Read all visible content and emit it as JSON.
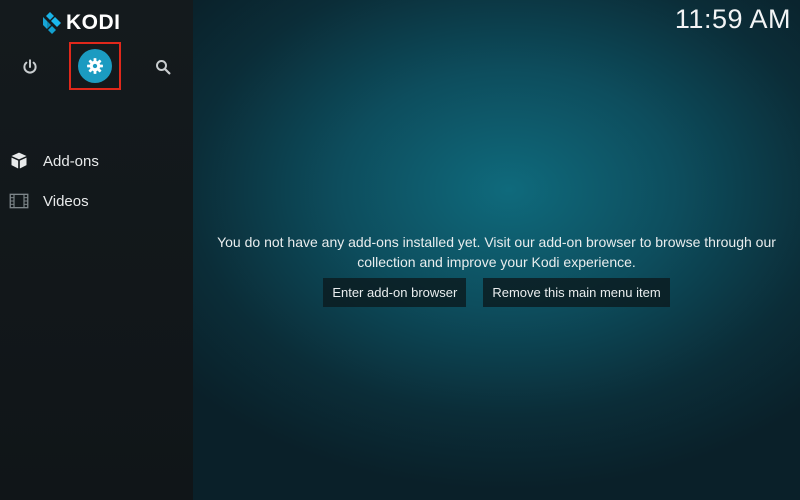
{
  "app": {
    "logo_text": "KODI",
    "clock": "11:59 AM"
  },
  "top_bar": {
    "power_icon": "power-icon",
    "settings_icon": "gear-icon",
    "search_icon": "search-icon",
    "settings_highlight_color": "#e0281b",
    "settings_bg_color": "#1b9bc1"
  },
  "menu": {
    "items": [
      {
        "label": "Add-ons",
        "icon": "addons-box-icon"
      },
      {
        "label": "Videos",
        "icon": "film-strip-icon"
      }
    ]
  },
  "main": {
    "message_line1": "You do not have any add-ons installed yet. Visit our add-on browser to browse through our",
    "message_line2": "collection and improve your Kodi experience.",
    "buttons": {
      "enter_browser": "Enter add-on browser",
      "remove_item": "Remove this main menu item"
    }
  }
}
